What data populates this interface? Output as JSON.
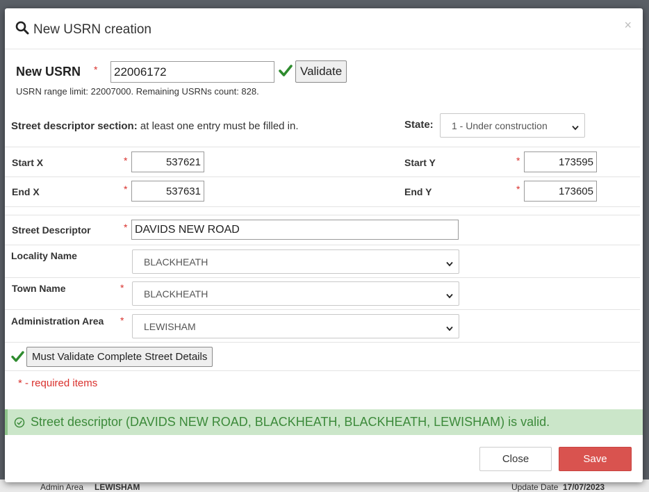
{
  "background": {
    "admin_area_label": "Admin Area",
    "admin_area_value": "LEWISHAM",
    "update_date_label": "Update Date",
    "update_date_value": "17/07/2023"
  },
  "modal": {
    "title": "New USRN creation",
    "close_glyph": "×"
  },
  "usrn": {
    "label": "New USRN",
    "required_mark": "*",
    "value": "22006172",
    "validate_label": "Validate",
    "range_info": "USRN range limit: 22007000. Remaining USRNs count: 828."
  },
  "street_section": {
    "heading_bold": "Street descriptor section:",
    "heading_rest": "at least one entry must be filled in.",
    "state_label": "State:",
    "state_value": "1 - Under construction"
  },
  "coords": {
    "start_x_label": "Start X",
    "start_x_value": "537621",
    "start_y_label": "Start Y",
    "start_y_value": "173595",
    "end_x_label": "End X",
    "end_x_value": "537631",
    "end_y_label": "End Y",
    "end_y_value": "173605"
  },
  "details": {
    "street_descriptor_label": "Street Descriptor",
    "street_descriptor_value": "DAVIDS NEW ROAD",
    "locality_label": "Locality Name",
    "locality_value": "BLACKHEATH",
    "town_label": "Town Name",
    "town_value": "BLACKHEATH",
    "admin_label": "Administration Area",
    "admin_value": "LEWISHAM",
    "validate_street_label": "Must Validate Complete Street Details",
    "required_note": "* - required items"
  },
  "alert": {
    "message": "Street descriptor (DAVIDS NEW ROAD, BLACKHEATH, BLACKHEATH, LEWISHAM) is valid."
  },
  "footer": {
    "close_label": "Close",
    "save_label": "Save"
  },
  "colors": {
    "required": "#d9302c",
    "success_green": "#3c8a3a",
    "save_red": "#d9534f",
    "check_green": "#2e8b2e"
  }
}
